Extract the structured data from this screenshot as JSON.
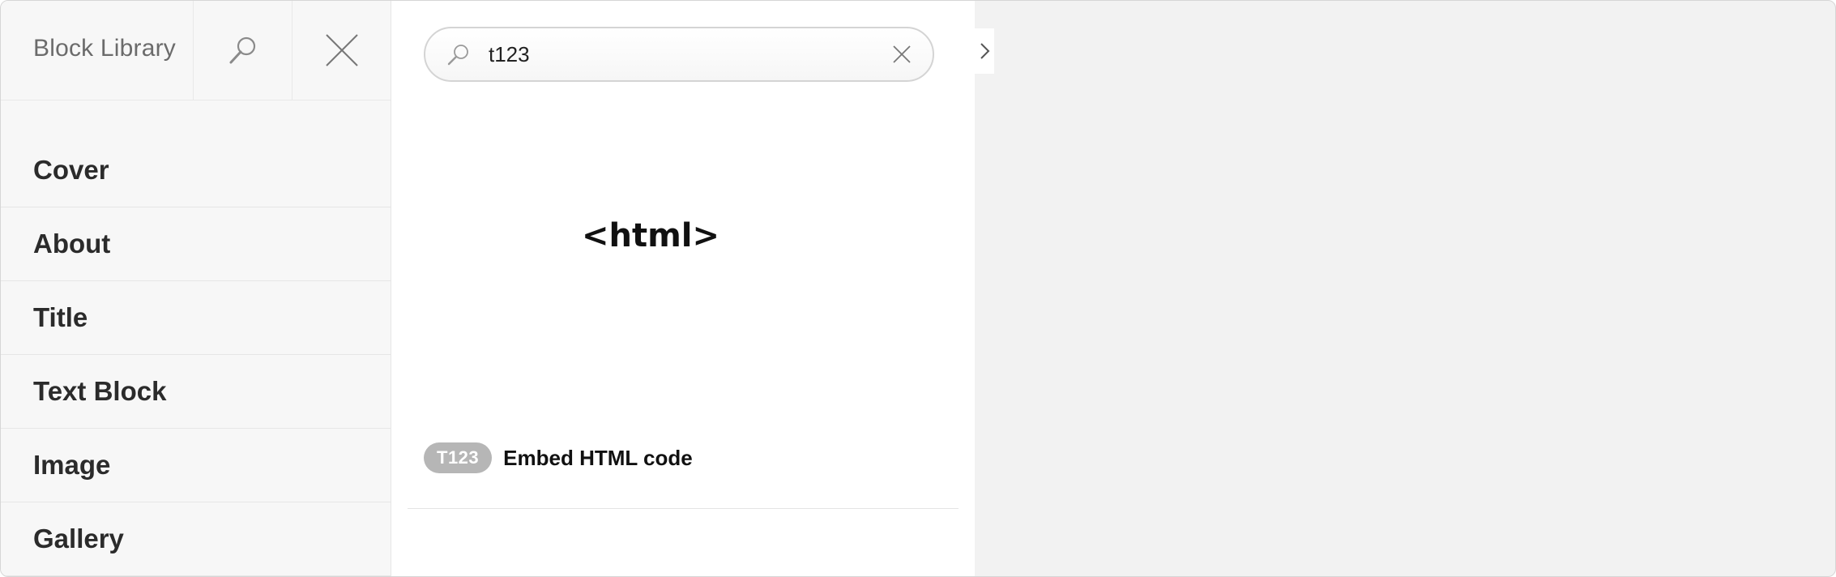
{
  "sidebar": {
    "title": "Block Library",
    "search_icon": "search-icon",
    "close_icon": "close-icon",
    "items": [
      {
        "label": "Cover"
      },
      {
        "label": "About"
      },
      {
        "label": "Title"
      },
      {
        "label": "Text Block"
      },
      {
        "label": "Image"
      },
      {
        "label": "Gallery"
      }
    ]
  },
  "search": {
    "value": "t123",
    "placeholder": "",
    "icon": "search-icon",
    "clear_icon": "close-icon"
  },
  "results": [
    {
      "preview_text": "<html>",
      "code": "T123",
      "name": "Embed HTML code"
    }
  ],
  "expand_icon": "chevron-right-icon",
  "colors": {
    "sidebar_bg": "#f7f7f7",
    "canvas_bg": "#f2f2f2",
    "badge_bg": "#b6b6b6"
  }
}
